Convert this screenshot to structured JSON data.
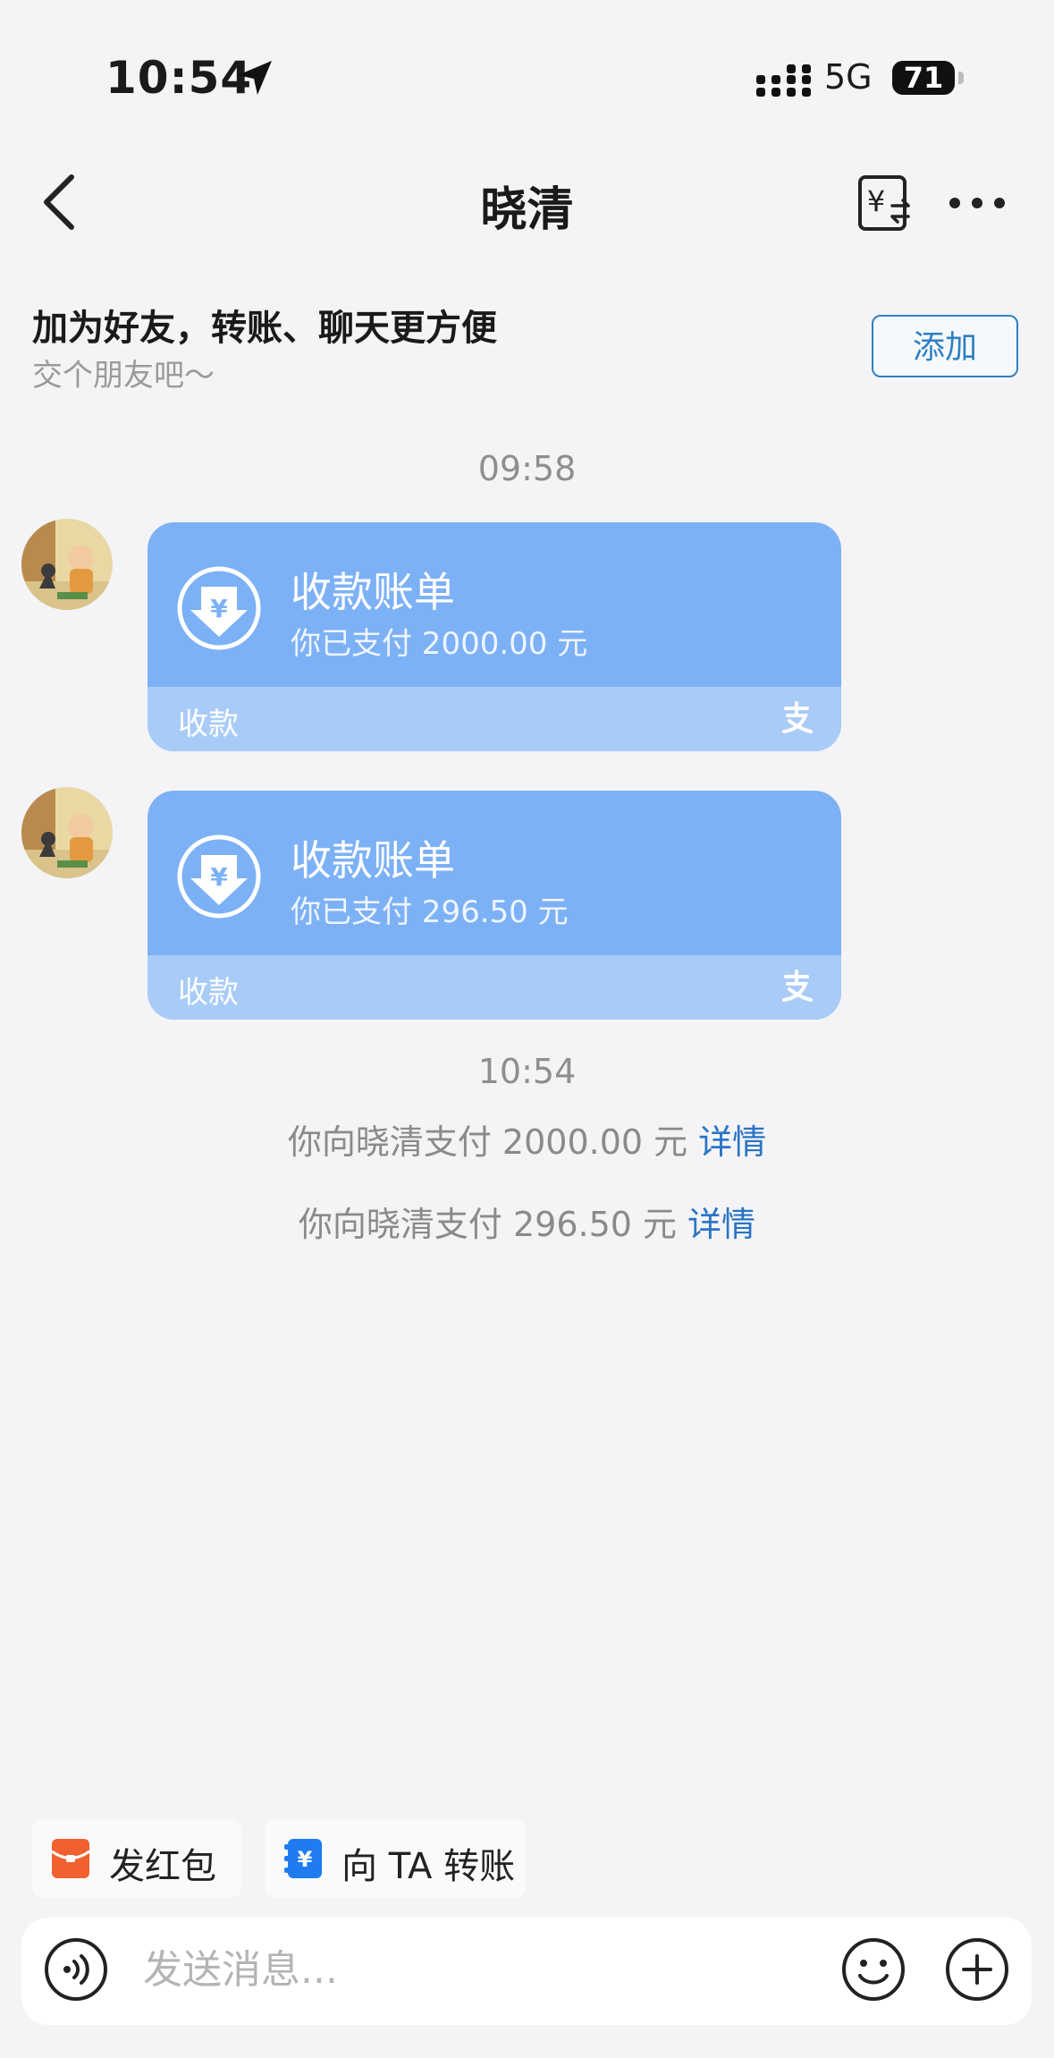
{
  "status_bar": {
    "time": "10:54",
    "network": "5G",
    "battery": "71"
  },
  "nav": {
    "title": "晓清",
    "back_icon": "chevron-left-icon",
    "transfer_icon": "yuan-transfer-icon",
    "more_icon": "more-dots-icon"
  },
  "friend_banner": {
    "title": "加为好友，转账、聊天更方便",
    "subtitle": "交个朋友吧～",
    "add_label": "添加"
  },
  "messages": {
    "time1": "09:58",
    "bills": [
      {
        "title": "收款账单",
        "subtitle": "你已支付 2000.00 元",
        "footer": "收款",
        "icon": "yuan-download-icon",
        "brand_icon": "alipay-logo-icon"
      },
      {
        "title": "收款账单",
        "subtitle": "你已支付 296.50 元",
        "footer": "收款",
        "icon": "yuan-download-icon",
        "brand_icon": "alipay-logo-icon"
      }
    ],
    "time2": "10:54",
    "notices": [
      {
        "text": "你向晓清支付 2000.00 元",
        "link": "详情"
      },
      {
        "text": "你向晓清支付 296.50 元",
        "link": "详情"
      }
    ]
  },
  "quick_actions": [
    {
      "label": "发红包",
      "icon": "red-packet-icon",
      "color": "#f0612f"
    },
    {
      "label": "向 TA 转账",
      "icon": "transfer-yuan-icon",
      "color": "#1e7cf0"
    }
  ],
  "input": {
    "placeholder": "发送消息..."
  },
  "colors": {
    "accent": "#2a74c4",
    "bill_card": "#7db1f5",
    "bill_footer": "#a9cbf7"
  }
}
